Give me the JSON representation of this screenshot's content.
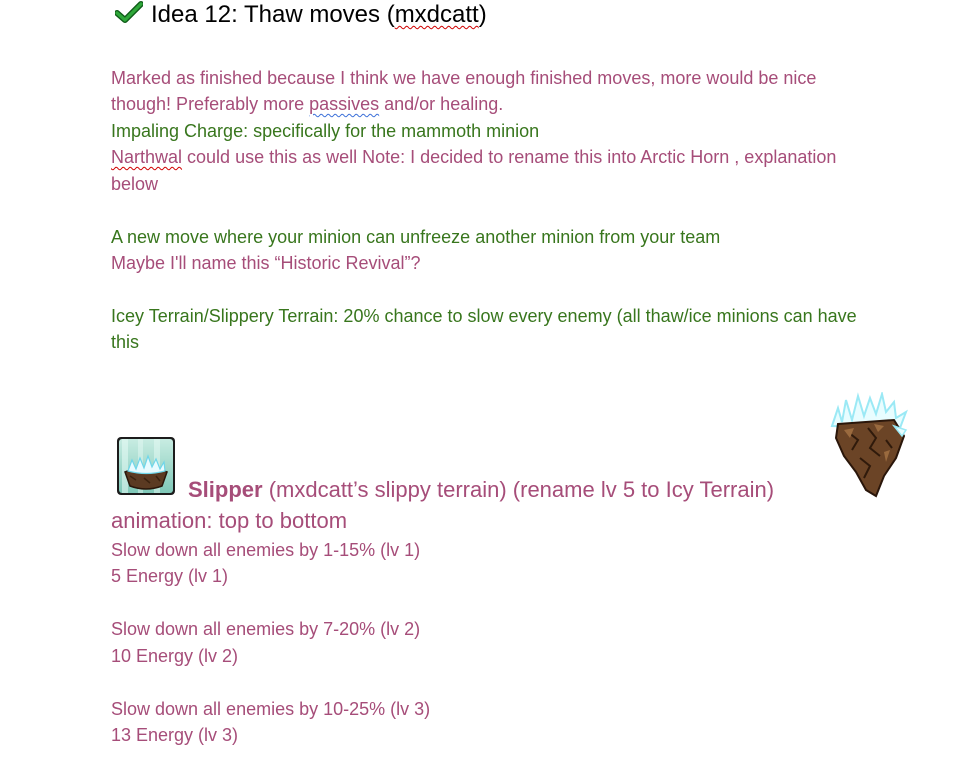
{
  "heading": {
    "check_icon": "green-checkmark-icon",
    "text_prefix": "Idea 12: Thaw moves (",
    "text_author": "mxdcatt",
    "text_suffix": ")"
  },
  "intro": {
    "line1": "Marked as finished because I think we have enough finished moves, more would be nice",
    "line2_pre": "though! Preferably more ",
    "line2_word": "passives",
    "line2_post": " and/or healing."
  },
  "ideas": {
    "impaling": "Impaling Charge: specifically for the mammoth minion",
    "narthwal_word": "Narthwal",
    "narthwal_rest": " could use this as well Note: I decided to rename this into Arctic Horn , explanation",
    "narthwal_below": "below",
    "unfreeze": "A new move where your minion can unfreeze another minion from your team",
    "revival": "Maybe I'll name this “Historic Revival”?",
    "terrain_line1": "Icey Terrain/Slippery Terrain: 20% chance to slow every enemy (all thaw/ice minions can have",
    "terrain_line2": "this"
  },
  "slipper": {
    "icon": "icy-rock-move-icon",
    "minion_art": "ice-crystal-rock-minion",
    "name": "Slipper",
    "desc": " (mxdcatt’s slippy terrain) (rename lv 5 to Icy Terrain)",
    "animation": "animation: top to bottom",
    "levels": [
      {
        "effect": "Slow down all enemies by 1-15% (lv 1)",
        "energy": "5 Energy (lv 1)"
      },
      {
        "effect": "Slow down all enemies by 7-20% (lv 2)",
        "energy": "10 Energy (lv 2)"
      },
      {
        "effect": "Slow down all enemies by 10-25% (lv 3)",
        "energy": "13 Energy (lv 3)"
      }
    ]
  },
  "colors": {
    "magenta_text": "#a64d79",
    "green_text": "#38761d",
    "check_green": "#1e8f2a"
  }
}
